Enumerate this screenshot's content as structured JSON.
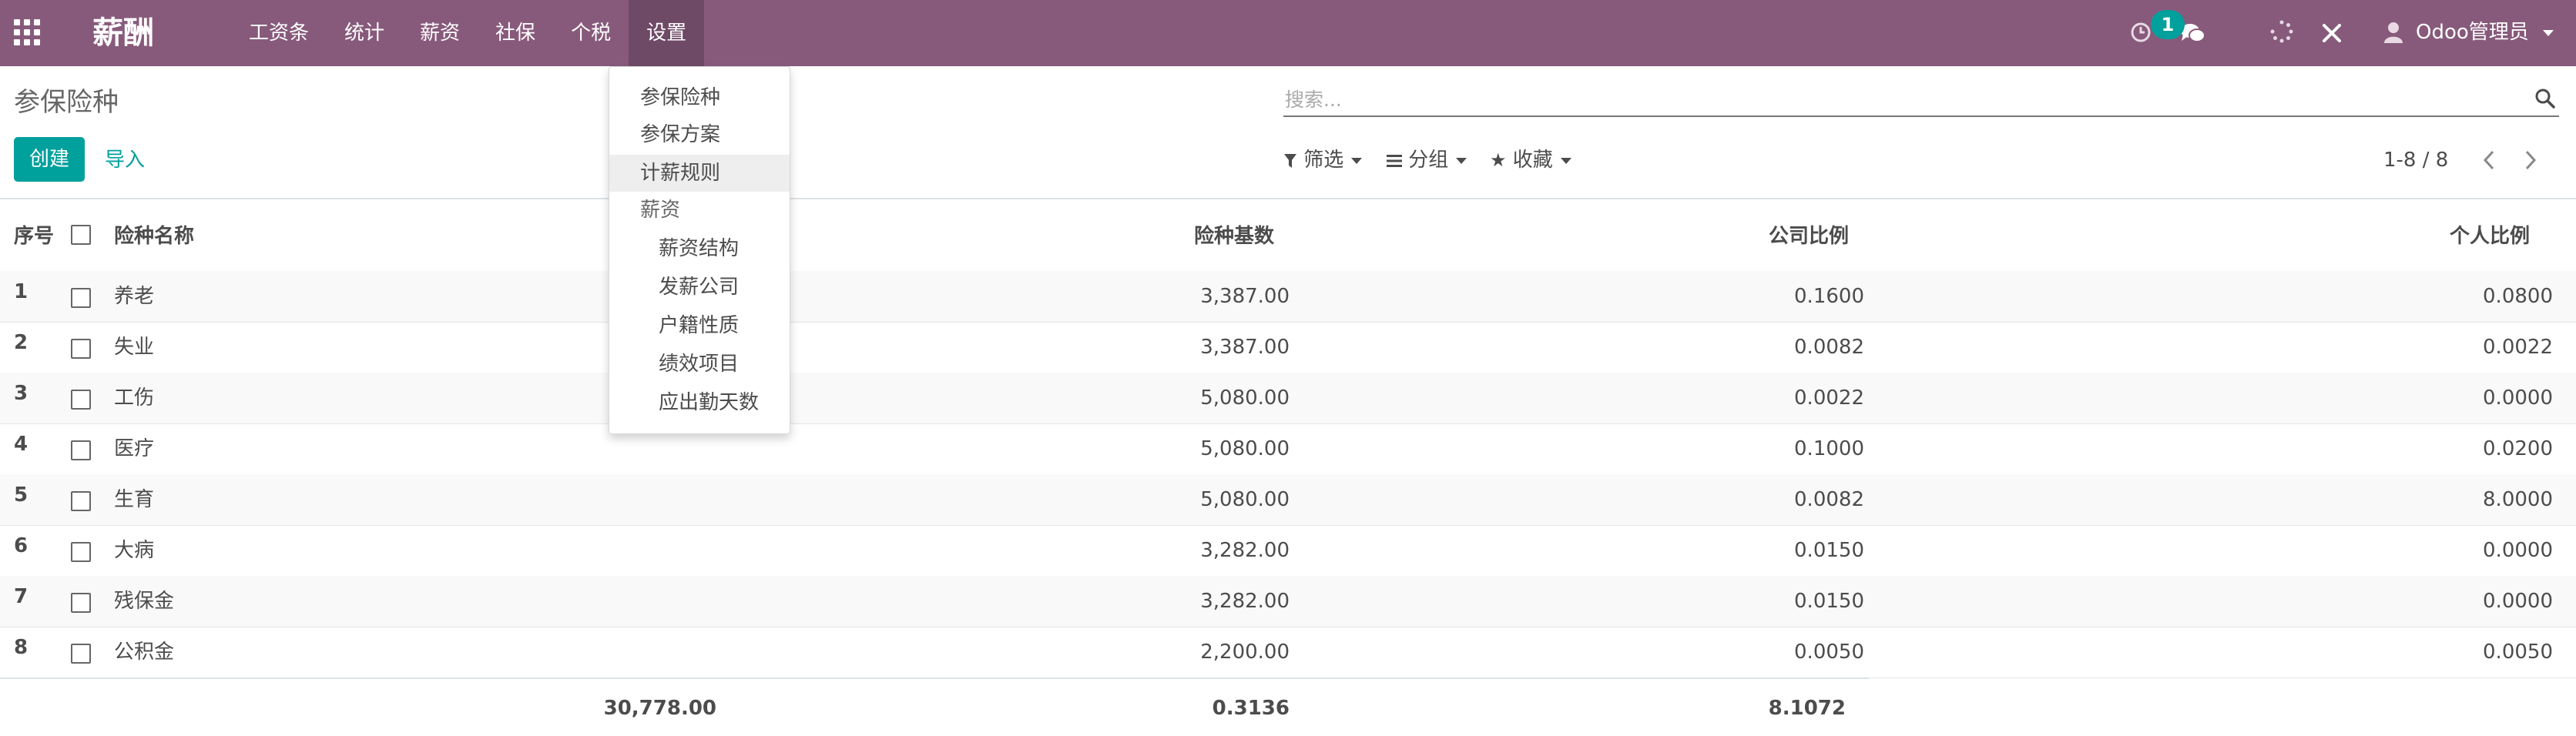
{
  "navbar": {
    "app_name": "薪酬",
    "menu": [
      "工资条",
      "统计",
      "薪资",
      "社保",
      "个税",
      "设置"
    ],
    "active_menu": "设置",
    "message_count": "1",
    "user_name": "Odoo管理员",
    "icons": [
      "apps-icon",
      "clock-icon",
      "chat-icon",
      "spinner-icon",
      "tools-icon",
      "user-icon"
    ]
  },
  "control": {
    "title": "参保险种",
    "create_label": "创建",
    "import_label": "导入",
    "search_placeholder": "搜索...",
    "filter_label": "筛选",
    "group_label": "分组",
    "favorites_label": "收藏",
    "pager_text": "1-8 / 8"
  },
  "table": {
    "columns": [
      "序号",
      "险种名称",
      "险种基数",
      "公司比例",
      "个人比例"
    ],
    "rows": [
      {
        "seq": "1",
        "name": "养老",
        "base": "3,387.00",
        "company": "0.1600",
        "personal": "0.0800"
      },
      {
        "seq": "2",
        "name": "失业",
        "base": "3,387.00",
        "company": "0.0082",
        "personal": "0.0022"
      },
      {
        "seq": "3",
        "name": "工伤",
        "base": "5,080.00",
        "company": "0.0022",
        "personal": "0.0000"
      },
      {
        "seq": "4",
        "name": "医疗",
        "base": "5,080.00",
        "company": "0.1000",
        "personal": "0.0200"
      },
      {
        "seq": "5",
        "name": "生育",
        "base": "5,080.00",
        "company": "0.0082",
        "personal": "8.0000"
      },
      {
        "seq": "6",
        "name": "大病",
        "base": "3,282.00",
        "company": "0.0150",
        "personal": "0.0000"
      },
      {
        "seq": "7",
        "name": "残保金",
        "base": "3,282.00",
        "company": "0.0150",
        "personal": "0.0000"
      },
      {
        "seq": "8",
        "name": "公积金",
        "base": "2,200.00",
        "company": "0.0050",
        "personal": "0.0050"
      }
    ],
    "totals": {
      "base": "30,778.00",
      "company": "0.3136",
      "personal": "8.1072"
    }
  },
  "dropdown": {
    "items": [
      "参保险种",
      "参保方案",
      "计薪规则"
    ],
    "header": "薪资",
    "sub_items": [
      "薪资结构",
      "发薪公司",
      "户籍性质",
      "绩效项目",
      "应出勤天数"
    ],
    "highlighted": "计薪规则"
  },
  "colors": {
    "brand": "#875a7b",
    "accent": "#00a09d"
  }
}
